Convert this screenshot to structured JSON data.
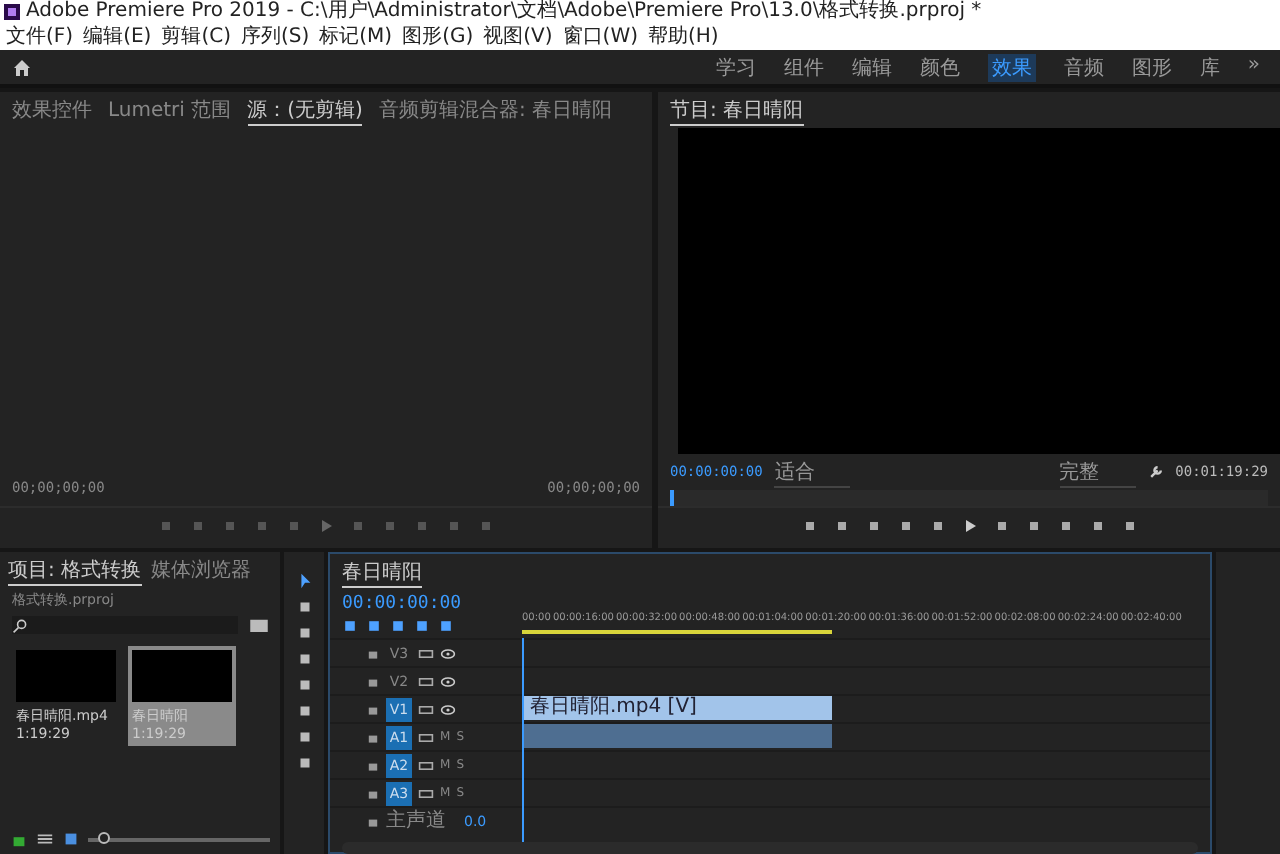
{
  "window": {
    "title": "Adobe Premiere Pro 2019 - C:\\用户\\Administrator\\文档\\Adobe\\Premiere Pro\\13.0\\格式转换.prproj *"
  },
  "menu": [
    "文件(F)",
    "编辑(E)",
    "剪辑(C)",
    "序列(S)",
    "标记(M)",
    "图形(G)",
    "视图(V)",
    "窗口(W)",
    "帮助(H)"
  ],
  "workspaces": [
    {
      "label": "学习",
      "selected": false
    },
    {
      "label": "组件",
      "selected": false
    },
    {
      "label": "编辑",
      "selected": false
    },
    {
      "label": "颜色",
      "selected": false
    },
    {
      "label": "效果",
      "selected": true
    },
    {
      "label": "音频",
      "selected": false
    },
    {
      "label": "图形",
      "selected": false
    },
    {
      "label": "库",
      "selected": false
    },
    {
      "label": "»",
      "selected": false
    }
  ],
  "source_panel": {
    "tabs": [
      {
        "label": "效果控件",
        "selected": false
      },
      {
        "label": "Lumetri 范围",
        "selected": false
      },
      {
        "label": "源：(无剪辑)",
        "selected": true
      },
      {
        "label": "音频剪辑混合器: 春日晴阳",
        "selected": false
      }
    ],
    "timecode_left": "00;00;00;00",
    "timecode_right": "00;00;00;00"
  },
  "program_panel": {
    "tab": "节目: 春日晴阳",
    "timecode": "00:00:00:00",
    "zoom": "适合",
    "quality": "完整",
    "duration": "00:01:19:29"
  },
  "project_panel": {
    "tabs": [
      {
        "label": "项目: 格式转换",
        "selected": true
      },
      {
        "label": "媒体浏览器",
        "selected": false
      }
    ],
    "file": "格式转换.prproj",
    "zoom": {
      "level": 0.05
    },
    "items": [
      {
        "name": "春日晴阳.mp4",
        "duration": "1:19:29",
        "selected": false
      },
      {
        "name": "春日晴阳",
        "duration": "1:19:29",
        "selected": true
      }
    ]
  },
  "timeline": {
    "tab": "春日晴阳",
    "timecode": "00:00:00:00",
    "ruler": [
      "00:00",
      "00:00:16:00",
      "00:00:32:00",
      "00:00:48:00",
      "00:01:04:00",
      "00:01:20:00",
      "00:01:36:00",
      "00:01:52:00",
      "00:02:08:00",
      "00:02:24:00",
      "00:02:40:00"
    ],
    "tracks": [
      {
        "kind": "video",
        "label": "V3",
        "targeted": false
      },
      {
        "kind": "video",
        "label": "V2",
        "targeted": false
      },
      {
        "kind": "video",
        "label": "V1",
        "targeted": true,
        "clip": "春日晴阳.mp4 [V]"
      },
      {
        "kind": "audio",
        "label": "A1",
        "targeted": true,
        "buttons": [
          "M",
          "S"
        ],
        "has_clip": true
      },
      {
        "kind": "audio",
        "label": "A2",
        "targeted": true,
        "buttons": [
          "M",
          "S"
        ]
      },
      {
        "kind": "audio",
        "label": "A3",
        "targeted": true,
        "buttons": [
          "M",
          "S"
        ]
      },
      {
        "kind": "master",
        "label": "主声道",
        "value": "0.0"
      }
    ]
  }
}
